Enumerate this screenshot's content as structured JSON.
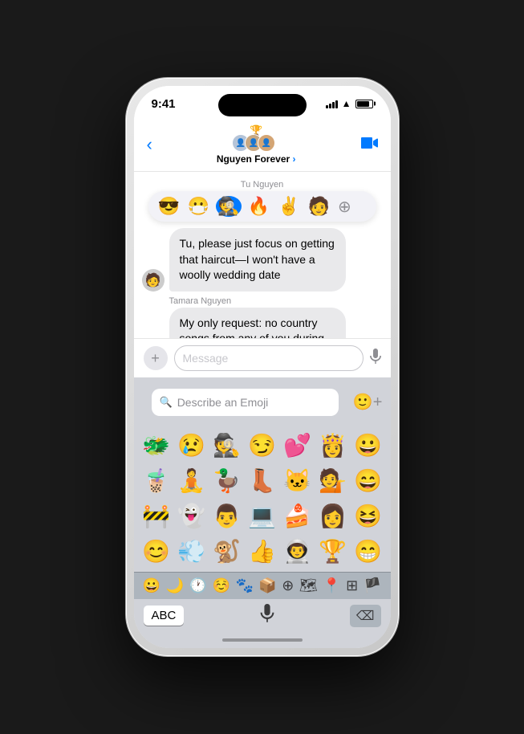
{
  "status_bar": {
    "time": "9:41",
    "signal_bars": [
      4,
      6,
      8,
      10,
      12
    ],
    "battery_label": "battery"
  },
  "nav": {
    "back_label": "‹",
    "group_name": "Nguyen Forever",
    "group_arrow": "›",
    "video_icon": "📹"
  },
  "reactions": {
    "emojis": [
      "😎",
      "😷",
      "🕵️",
      "🔥",
      "✌️",
      "🧑"
    ],
    "selected_index": 2,
    "add_label": "⊕"
  },
  "messages": {
    "sender_tu": "Tu Nguyen",
    "bubble1": {
      "sender": "Tu, please just focus on getting that haircut—I won't have a woolly wedding date",
      "type": "received"
    },
    "sender_tamara": "Tamara Nguyen",
    "bubble2": {
      "text": "My only request: no country songs from any of you during karaoke at the reception",
      "type": "received"
    }
  },
  "input_bar": {
    "placeholder": "Message",
    "plus_label": "+",
    "mic_label": "🎤"
  },
  "emoji_keyboard": {
    "search_placeholder": "Describe an Emoji",
    "sticker_btn": "🙂+",
    "emojis_row1": [
      "🐲",
      "😢",
      "🕵️",
      "😏",
      "💕",
      "👸",
      "😀"
    ],
    "emojis_row2": [
      "🧋",
      "🧘",
      "🦆",
      "👢",
      "🐱",
      "💁",
      "😄"
    ],
    "emojis_row3": [
      "🚧",
      "👻",
      "👨",
      "💻",
      "🍰",
      "👩",
      "😆"
    ],
    "emojis_row4": [
      "😊",
      "💨",
      "🐒",
      "👍",
      "👨‍🚀",
      "🏆",
      "😁"
    ]
  },
  "keyboard_toolbar": {
    "icons": [
      "😀",
      "🌙",
      "🕐",
      "☺️",
      "🐾",
      "📦",
      "⊕",
      "🗺",
      "📍",
      "⊞",
      "🏴"
    ]
  },
  "keyboard_bottom": {
    "abc_label": "ABC",
    "delete_label": "⌫",
    "mic_label": "🎤"
  }
}
